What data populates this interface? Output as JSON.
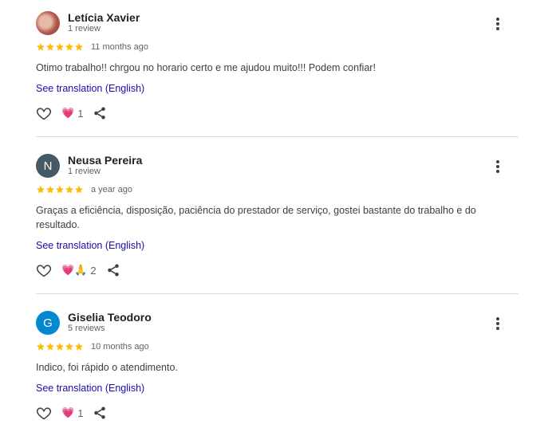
{
  "colors": {
    "star": "#fbbc04",
    "link": "#1a0dab",
    "heart": "#e91e63"
  },
  "reviews": [
    {
      "name": "Letícia Xavier",
      "meta": "1 review",
      "avatar_letter": "",
      "avatar_color": "",
      "rating": 5,
      "time": "11 months ago",
      "text": "Otimo trabalho!! chrgou no horario certo e me ajudou muito!!! Podem confiar!",
      "translate_label": "See translation (English)",
      "reactions": "💗",
      "reaction_count": "1"
    },
    {
      "name": "Neusa Pereira",
      "meta": "1 review",
      "avatar_letter": "N",
      "avatar_color": "#455a64",
      "rating": 5,
      "time": "a year ago",
      "text": "Graças a eficiência, disposição, paciência do prestador de serviço, gostei bastante do trabalho e do resultado.",
      "translate_label": "See translation (English)",
      "reactions": "💗🙏",
      "reaction_count": "2"
    },
    {
      "name": "Giselia Teodoro",
      "meta": "5 reviews",
      "avatar_letter": "G",
      "avatar_color": "#0288d1",
      "rating": 5,
      "time": "10 months ago",
      "text": "Indico, foi rápido o atendimento.",
      "translate_label": "See translation (English)",
      "reactions": "💗",
      "reaction_count": "1"
    }
  ]
}
